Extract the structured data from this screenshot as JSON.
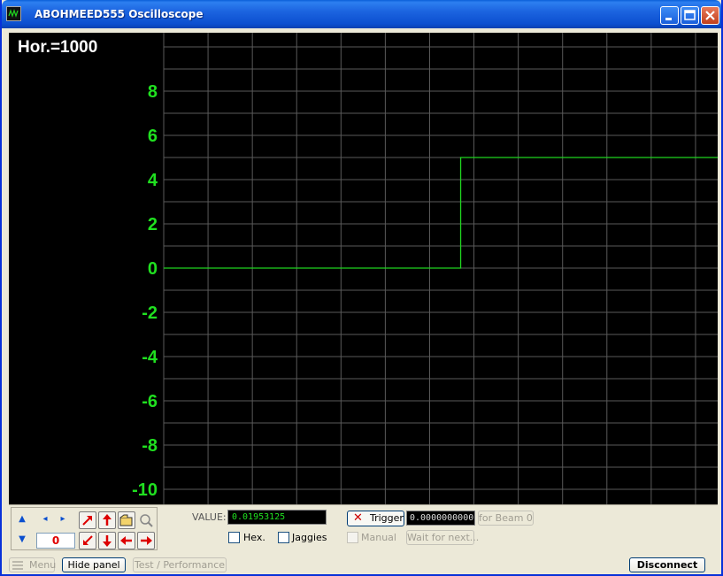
{
  "window": {
    "title": "ABOHMEED555 Oscilloscope"
  },
  "colors": {
    "trace": "#1fd41f",
    "axis_labels": "#20e020",
    "grid": "#5a5a5a",
    "background": "#000000"
  },
  "chart_data": {
    "type": "line",
    "title": "Hor.=1000",
    "xlabel": "",
    "ylabel": "",
    "ylim": [
      -11,
      10.5
    ],
    "yticks": [
      "8",
      "6",
      "4",
      "2",
      "0",
      "-2",
      "-4",
      "-6",
      "-8",
      "-10"
    ],
    "grid": true,
    "x_divisions": 12.5,
    "series": [
      {
        "x": [
          0,
          6.7,
          6.7,
          12.5
        ],
        "values": [
          0,
          0,
          5,
          5
        ]
      }
    ]
  },
  "panel": {
    "zero_value": "0",
    "value_label": "VALUE:",
    "value": "0.01953125",
    "hex_label": "Hex.",
    "jaggies_label": "Jaggies",
    "trigger_label": "Trigger",
    "trigger_value": "0.0000000000",
    "beam_button": "for Beam 0",
    "manual_label": "Manual",
    "wait_button": "Wait for next..."
  },
  "bottom": {
    "menu_label": "Menu",
    "hide_panel": "Hide panel",
    "test_performance": "Test / Performance",
    "disconnect": "Disconnect"
  }
}
